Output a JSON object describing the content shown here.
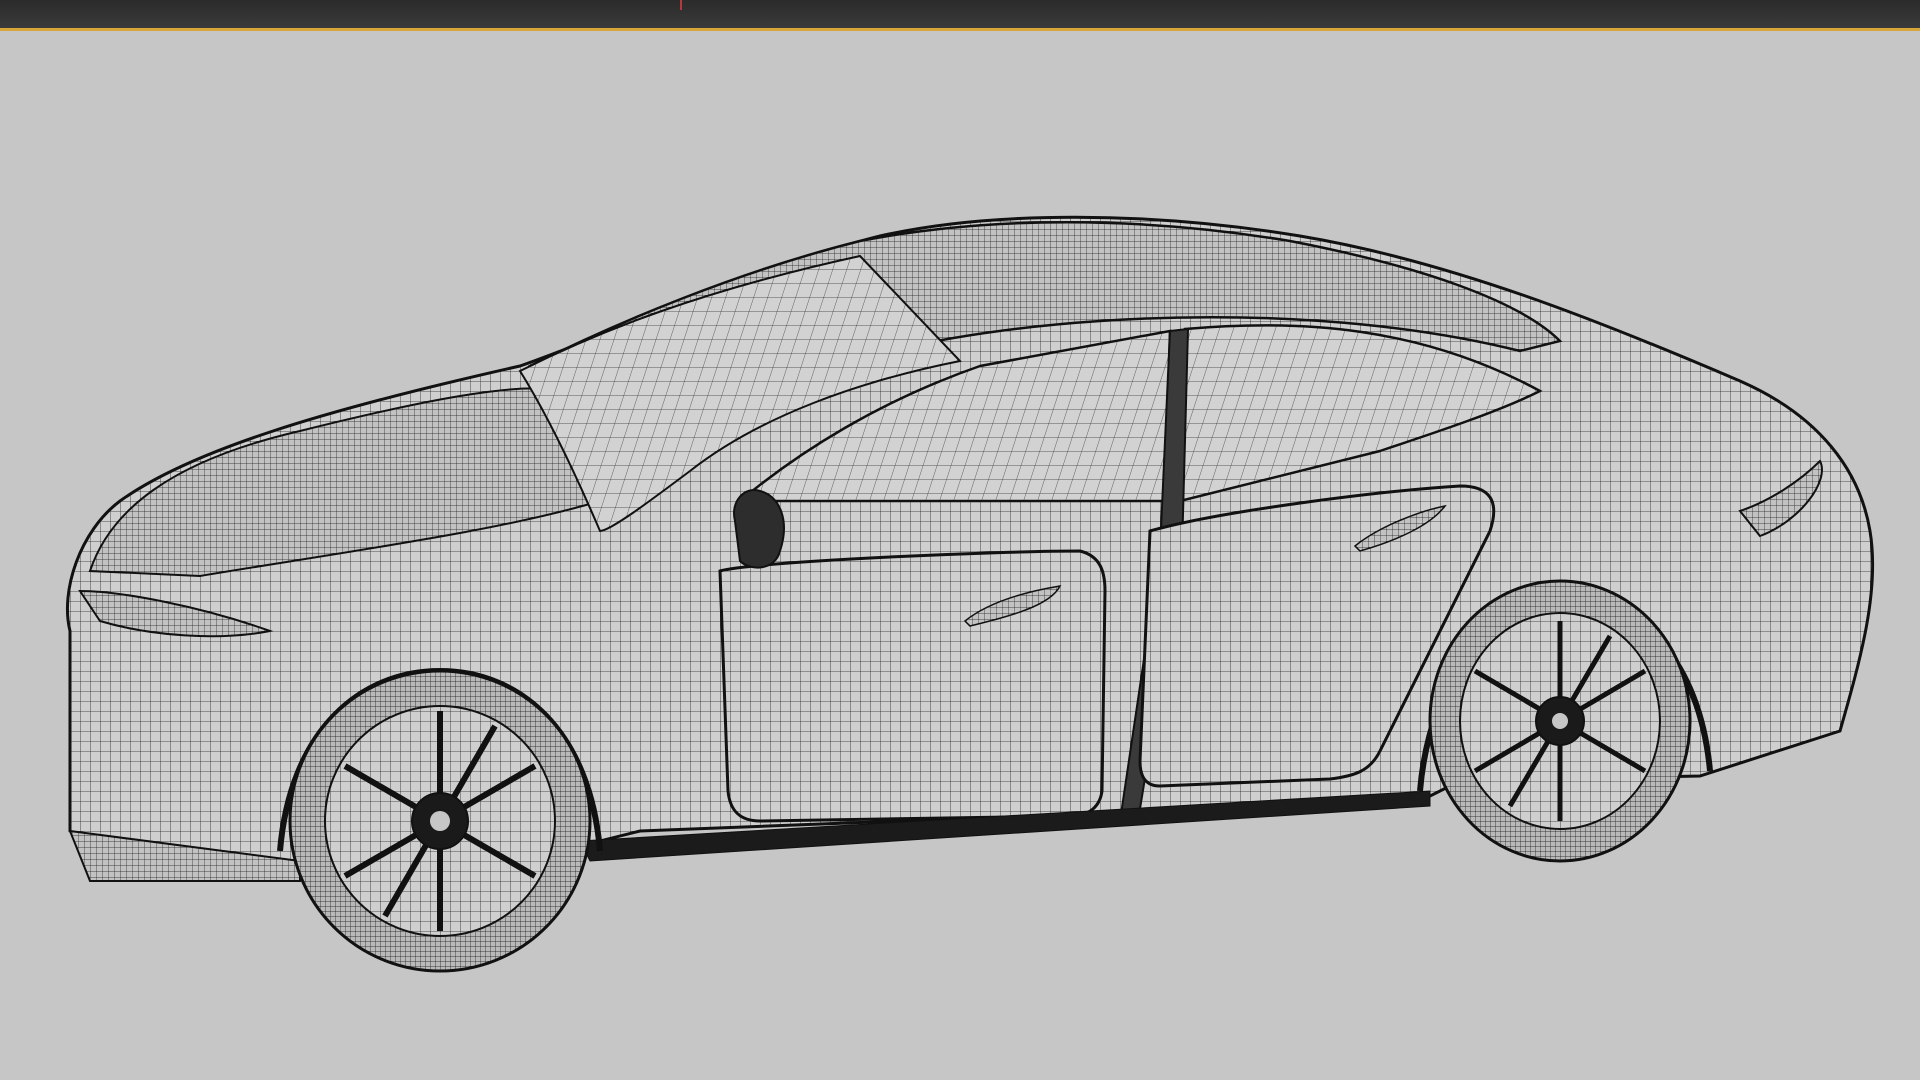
{
  "viewport": {
    "background": "#c6c6c6",
    "object": "car-wireframe-mesh",
    "shading": "wireframe"
  },
  "topbar": {
    "background": "#2f2f2f",
    "accent_color": "#d9a63a",
    "marker_color": "#b23a3a"
  },
  "icons": {
    "wheel_front": "wheel-icon",
    "wheel_rear": "wheel-icon"
  }
}
